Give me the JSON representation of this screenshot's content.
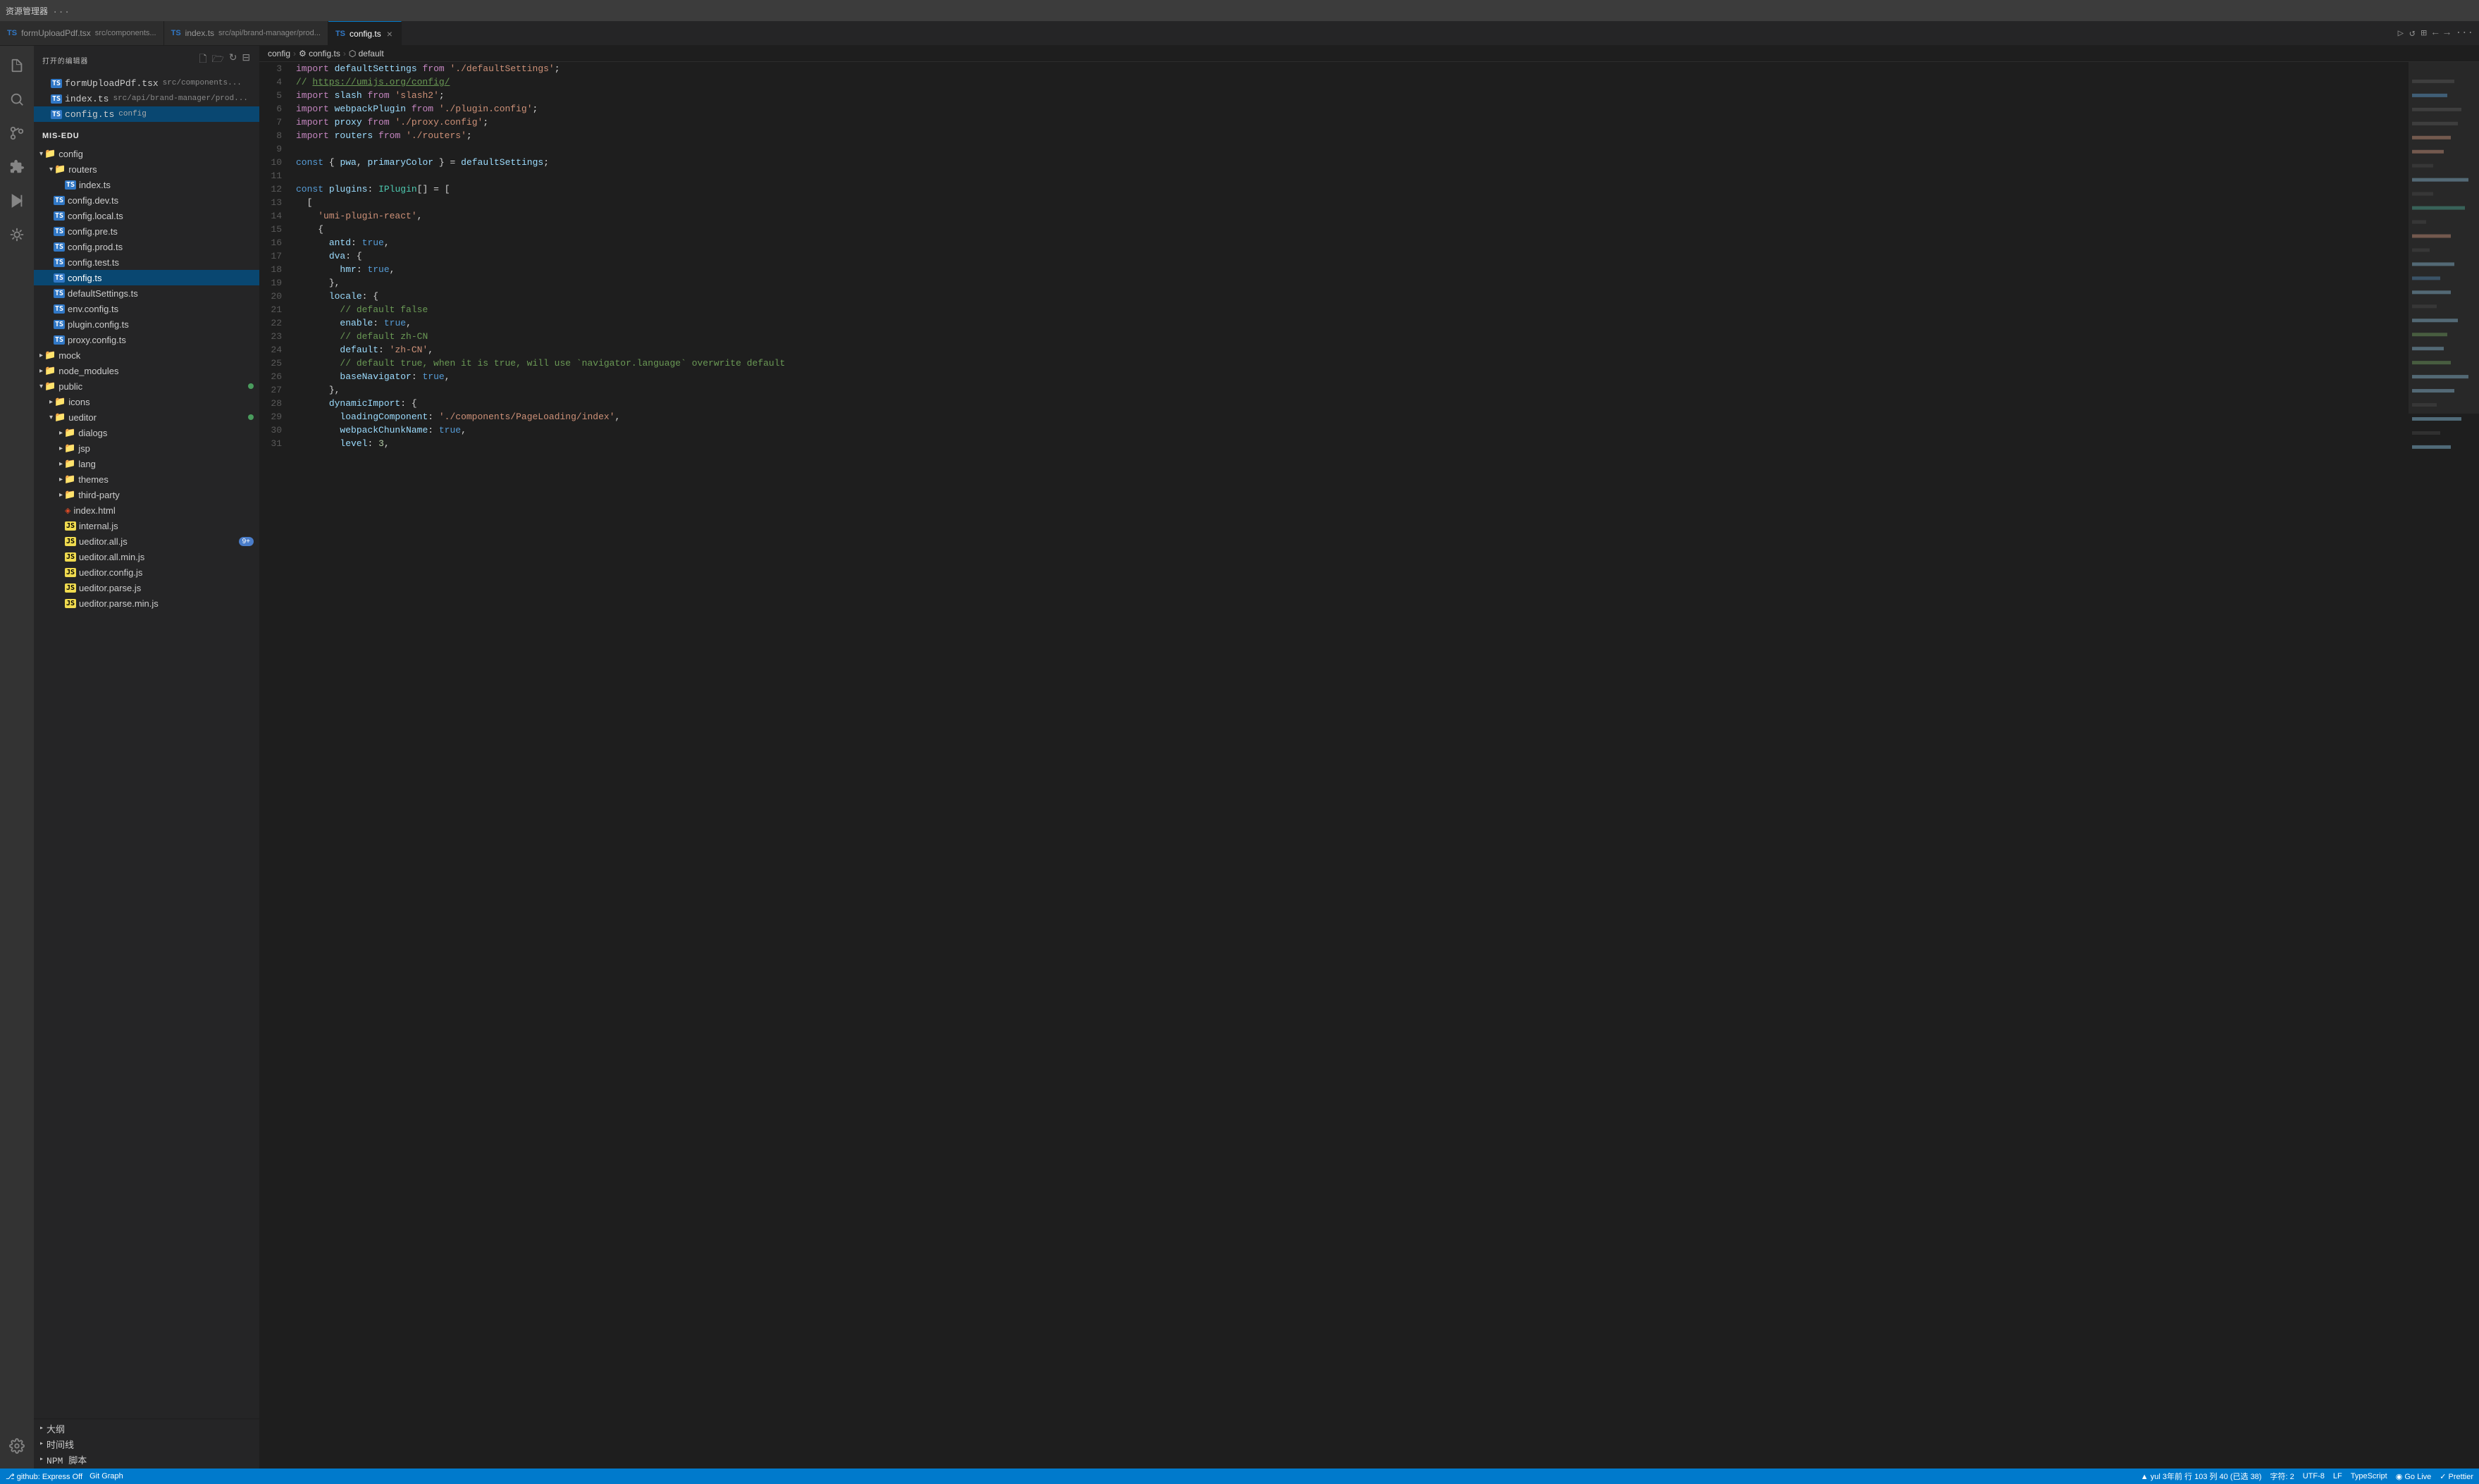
{
  "titleBar": {
    "explorerLabel": "资源管理器",
    "dotsLabel": "..."
  },
  "tabs": [
    {
      "id": "formUploadPdf",
      "icon": "TS",
      "label": "formUploadPdf.tsx",
      "active": false,
      "closable": false,
      "subtitle": "src/components..."
    },
    {
      "id": "indexTs",
      "icon": "TS",
      "label": "index.ts",
      "active": false,
      "closable": false,
      "subtitle": "src/api/brand-manager/prod..."
    },
    {
      "id": "configTs",
      "icon": "TS",
      "label": "config.ts",
      "active": true,
      "closable": true,
      "subtitle": "config"
    }
  ],
  "breadcrumb": {
    "items": [
      "config",
      "config.ts",
      "default"
    ]
  },
  "sidebar": {
    "title": "打开的编辑器",
    "explorerTitle": "资源管理器",
    "openEditors": [
      {
        "icon": "TS",
        "name": "formUploadPdf.tsx",
        "path": "src/components...",
        "dirty": false
      },
      {
        "icon": "TS",
        "name": "index.ts",
        "path": "src/api/brand-manager/prod...",
        "dirty": false
      },
      {
        "icon": "TS",
        "name": "config.ts",
        "path": "config",
        "dirty": false,
        "active": true
      }
    ],
    "projectName": "MIS-EDU",
    "tree": [
      {
        "type": "folder",
        "level": 1,
        "name": "config",
        "expanded": true
      },
      {
        "type": "folder",
        "level": 2,
        "name": "routers",
        "expanded": true
      },
      {
        "type": "file",
        "level": 3,
        "icon": "TS",
        "name": "index.ts"
      },
      {
        "type": "file",
        "level": 2,
        "icon": "TS",
        "name": "config.dev.ts"
      },
      {
        "type": "file",
        "level": 2,
        "icon": "TS",
        "name": "config.local.ts"
      },
      {
        "type": "file",
        "level": 2,
        "icon": "TS",
        "name": "config.pre.ts"
      },
      {
        "type": "file",
        "level": 2,
        "icon": "TS",
        "name": "config.prod.ts"
      },
      {
        "type": "file",
        "level": 2,
        "icon": "TS",
        "name": "config.test.ts"
      },
      {
        "type": "file",
        "level": 2,
        "icon": "TS",
        "name": "config.ts",
        "active": true,
        "selected": true
      },
      {
        "type": "file",
        "level": 2,
        "icon": "TS",
        "name": "defaultSettings.ts"
      },
      {
        "type": "file",
        "level": 2,
        "icon": "TS",
        "name": "env.config.ts"
      },
      {
        "type": "file",
        "level": 2,
        "icon": "TS",
        "name": "plugin.config.ts"
      },
      {
        "type": "file",
        "level": 2,
        "icon": "TS",
        "name": "proxy.config.ts"
      },
      {
        "type": "folder",
        "level": 1,
        "name": "mock",
        "expanded": false
      },
      {
        "type": "folder",
        "level": 1,
        "name": "node_modules",
        "expanded": false
      },
      {
        "type": "folder",
        "level": 1,
        "name": "public",
        "expanded": true,
        "badge": "dot-green"
      },
      {
        "type": "folder",
        "level": 2,
        "name": "icons",
        "expanded": false
      },
      {
        "type": "folder",
        "level": 2,
        "name": "ueditor",
        "expanded": true,
        "badge": "dot-green"
      },
      {
        "type": "folder",
        "level": 3,
        "name": "dialogs",
        "expanded": false
      },
      {
        "type": "folder",
        "level": 3,
        "name": "jsp",
        "expanded": false
      },
      {
        "type": "folder",
        "level": 3,
        "name": "lang",
        "expanded": false
      },
      {
        "type": "folder",
        "level": 3,
        "name": "themes",
        "expanded": false
      },
      {
        "type": "folder",
        "level": 3,
        "name": "third-party",
        "expanded": false
      },
      {
        "type": "file",
        "level": 3,
        "icon": "HTML",
        "name": "index.html"
      },
      {
        "type": "file",
        "level": 3,
        "icon": "JS",
        "name": "internal.js"
      },
      {
        "type": "file",
        "level": 3,
        "icon": "JS",
        "name": "ueditor.all.js",
        "badge": "9+"
      },
      {
        "type": "file",
        "level": 3,
        "icon": "JS",
        "name": "ueditor.all.min.js"
      },
      {
        "type": "file",
        "level": 3,
        "icon": "JS",
        "name": "ueditor.config.js"
      },
      {
        "type": "file",
        "level": 3,
        "icon": "JS",
        "name": "ueditor.parse.js"
      },
      {
        "type": "file",
        "level": 3,
        "icon": "JS",
        "name": "ueditor.parse.min.js"
      }
    ]
  },
  "bottomBar": {
    "items": [
      "大纲",
      "时间线",
      "NPM 脚本"
    ]
  },
  "statusBar": {
    "left": [
      {
        "icon": "branch",
        "label": "github: Express Off"
      },
      {
        "label": "Git Graph"
      }
    ],
    "right": [
      {
        "label": "▲ yul  3年前  行 103  列 40 (已选 38)"
      },
      {
        "label": "字符: 2"
      },
      {
        "label": "UTF-8"
      },
      {
        "label": "LF"
      },
      {
        "label": "TypeScript"
      },
      {
        "label": "◉ Go Live"
      },
      {
        "label": "✓ Prettier"
      }
    ]
  },
  "code": {
    "lines": [
      {
        "num": 3,
        "content": "import defaultSettings from './defaultSettings';"
      },
      {
        "num": 4,
        "content": "// https://umijs.org/config/"
      },
      {
        "num": 5,
        "content": "import slash from 'slash2';"
      },
      {
        "num": 6,
        "content": "import webpackPlugin from './plugin.config';"
      },
      {
        "num": 7,
        "content": "import proxy from './proxy.config';"
      },
      {
        "num": 8,
        "content": "import routers from './routers';"
      },
      {
        "num": 9,
        "content": ""
      },
      {
        "num": 10,
        "content": "const { pwa, primaryColor } = defaultSettings;"
      },
      {
        "num": 11,
        "content": ""
      },
      {
        "num": 12,
        "content": "const plugins: IPlugin[] = ["
      },
      {
        "num": 13,
        "content": "  ["
      },
      {
        "num": 14,
        "content": "    'umi-plugin-react',"
      },
      {
        "num": 15,
        "content": "    {"
      },
      {
        "num": 16,
        "content": "      antd: true,"
      },
      {
        "num": 17,
        "content": "      dva: {"
      },
      {
        "num": 18,
        "content": "        hmr: true,"
      },
      {
        "num": 19,
        "content": "      },"
      },
      {
        "num": 20,
        "content": "      locale: {"
      },
      {
        "num": 21,
        "content": "        // default false"
      },
      {
        "num": 22,
        "content": "        enable: true,"
      },
      {
        "num": 23,
        "content": "        // default zh-CN"
      },
      {
        "num": 24,
        "content": "        default: 'zh-CN',"
      },
      {
        "num": 25,
        "content": "        // default true, when it is true, will use `navigator.language` overwrite default"
      },
      {
        "num": 26,
        "content": "        baseNavigator: true,"
      },
      {
        "num": 27,
        "content": "      },"
      },
      {
        "num": 28,
        "content": "      dynamicImport: {"
      },
      {
        "num": 29,
        "content": "        loadingComponent: './components/PageLoading/index',"
      },
      {
        "num": 30,
        "content": "        webpackChunkName: true,"
      },
      {
        "num": 31,
        "content": "        level: 3,"
      }
    ]
  }
}
